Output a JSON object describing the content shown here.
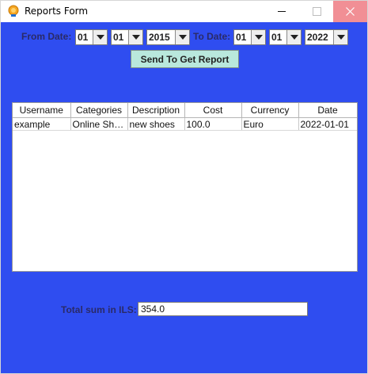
{
  "window": {
    "title": "Reports Form"
  },
  "filters": {
    "from_label": "From Date:",
    "from_day": "01",
    "from_month": "01",
    "from_year": "2015",
    "to_label": "To Date:",
    "to_day": "01",
    "to_month": "01",
    "to_year": "2022"
  },
  "send_button": "Send To Get Report",
  "table": {
    "columns": [
      "Username",
      "Categories",
      "Description",
      "Cost",
      "Currency",
      "Date"
    ],
    "rows": [
      [
        "example",
        "Online Sho...",
        "new shoes",
        "100.0",
        "Euro",
        "2022-01-01"
      ]
    ]
  },
  "total": {
    "label": "Total sum in ILS:",
    "value": "354.0"
  },
  "colors": {
    "background": "#2f4df0",
    "button": "#b9e8dc",
    "close_hover": "#f18f95"
  },
  "icons": [
    "app-icon",
    "minimize-icon",
    "maximize-icon",
    "close-icon",
    "dropdown-arrow-icon"
  ]
}
